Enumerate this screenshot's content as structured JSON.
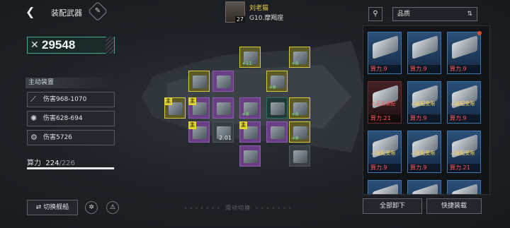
{
  "header": {
    "back_icon": "back-arrow-icon",
    "title": "装配武器",
    "edit_icon": "wrench-icon"
  },
  "player": {
    "name": "刘老猫",
    "level": "27",
    "ship": "G10.摩羯座"
  },
  "power": {
    "value": "29548",
    "icon": "crossed-swords-icon"
  },
  "active": {
    "header": "主动装置",
    "stats": [
      {
        "icon": "claw-icon",
        "text": "伤害968-1070"
      },
      {
        "icon": "flame-icon",
        "text": "伤害628-694"
      },
      {
        "icon": "gear-icon",
        "text": "伤害5726"
      }
    ]
  },
  "calc": {
    "label": "算力",
    "used": "224",
    "total": "/226",
    "fraction": 0.991
  },
  "footer": {
    "switch_ship": "切换舰船",
    "swipe": "滑动切换",
    "unequip_all": "全部卸下",
    "quick_equip": "快捷装载"
  },
  "sort": {
    "label": "品质"
  },
  "grid": {
    "main_tag": "主",
    "slots": [
      {
        "k": "y",
        "plus": "",
        "num": "",
        "main": true
      },
      {
        "k": "y",
        "plus": "",
        "num": "",
        "main": false
      },
      {
        "k": "p",
        "plus": "",
        "num": "",
        "main": false
      },
      {
        "k": "y",
        "plus": "+11",
        "num": "",
        "main": false
      },
      {
        "k": "y",
        "plus": "+8",
        "num": "",
        "main": false
      },
      {
        "k": "y",
        "plus": "+8",
        "num": "",
        "main": false
      },
      {
        "k": "p",
        "plus": "",
        "num": "",
        "main": true
      },
      {
        "k": "p",
        "plus": "",
        "num": "",
        "main": false
      },
      {
        "k": "p",
        "plus": "+8",
        "num": "",
        "main": false
      },
      {
        "k": "t",
        "plus": "",
        "num": "",
        "main": false
      },
      {
        "k": "y",
        "plus": "+8",
        "num": "",
        "main": false
      },
      {
        "k": "p",
        "plus": "",
        "num": "",
        "main": true
      },
      {
        "k": "n",
        "plus": "",
        "num": "2.01",
        "main": false
      },
      {
        "k": "p",
        "plus": "",
        "num": "",
        "main": true
      },
      {
        "k": "p",
        "plus": "",
        "num": "",
        "main": false
      },
      {
        "k": "y",
        "plus": "+8",
        "num": "",
        "main": false
      },
      {
        "k": "p",
        "plus": "",
        "num": "",
        "main": false
      },
      {
        "k": "n",
        "plus": "",
        "num": "",
        "main": false
      }
    ]
  },
  "inventory": [
    {
      "pw": "算力.9",
      "warn": "",
      "red": false
    },
    {
      "pw": "算力.9",
      "warn": "",
      "red": false
    },
    {
      "pw": "算力.9",
      "warn": "",
      "red": false
    },
    {
      "pw": "算力.21",
      "warn": "无法装配",
      "red": true
    },
    {
      "pw": "算力.9",
      "warn": "装配受限",
      "red": false
    },
    {
      "pw": "算力.9",
      "warn": "装配受限",
      "red": false
    },
    {
      "pw": "算力.9",
      "warn": "装配受限",
      "red": false
    },
    {
      "pw": "算力.9",
      "warn": "装配受限",
      "red": false
    },
    {
      "pw": "算力.21",
      "warn": "装配受限",
      "red": false
    },
    {
      "pw": "",
      "warn": "",
      "red": false
    },
    {
      "pw": "",
      "warn": "",
      "red": false
    },
    {
      "pw": "",
      "warn": "",
      "red": false
    }
  ]
}
